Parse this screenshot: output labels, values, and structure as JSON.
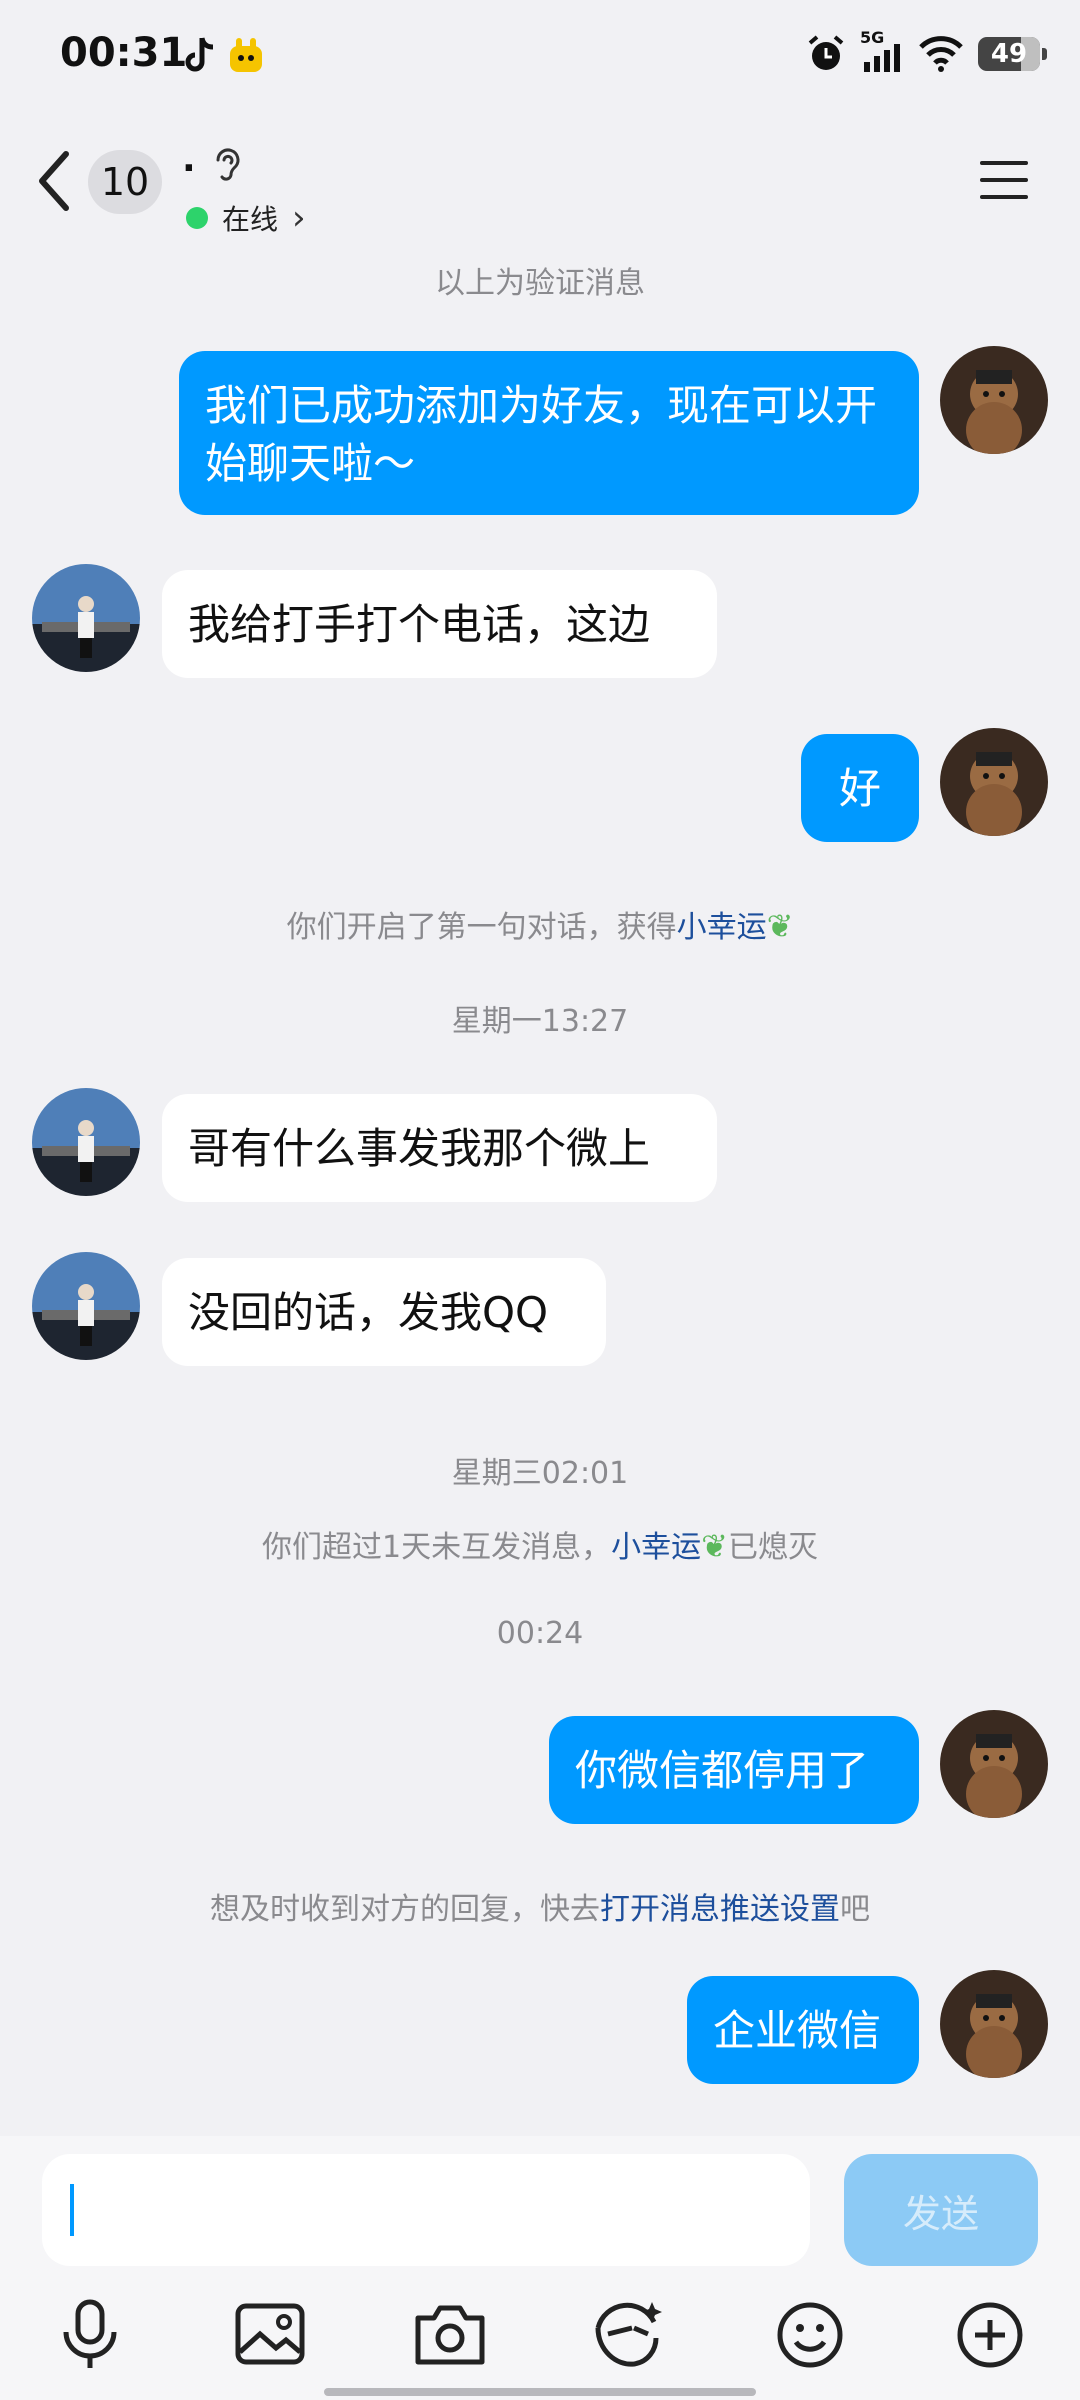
{
  "status_bar": {
    "time": "00:31",
    "signal_label": "5G",
    "battery": "49"
  },
  "header": {
    "back_count": "10",
    "contact_name": "·",
    "online_status": "在线",
    "chevron": "›"
  },
  "colors": {
    "accent": "#0099ff",
    "link": "#1d4f9c",
    "online": "#2dd36b"
  },
  "messages": {
    "verify_note": "以上为验证消息",
    "m1": "我们已成功添加为好友，现在可以开始聊天啦～",
    "m2": "我给打手打个电话，这边",
    "m3": "好",
    "sys1_prefix": "你们开启了第一句对话，获得",
    "sys1_link": "小幸运",
    "time1": "星期一13:27",
    "m4": "哥有什么事发我那个微上",
    "m5": "没回的话，发我QQ",
    "time2": "星期三02:01",
    "sys2_prefix": "你们超过1天未互发消息，",
    "sys2_link": "小幸运",
    "sys2_suffix": "已熄灭",
    "time3": "00:24",
    "m6": "你微信都停用了",
    "sys3_prefix": "想及时收到对方的回复，快去",
    "sys3_link": "打开消息推送设置",
    "sys3_suffix": "吧",
    "m7": "企业微信"
  },
  "input": {
    "value": "",
    "send_label": "发送"
  },
  "toolbar": {
    "icons": [
      "microphone-icon",
      "image-icon",
      "camera-icon",
      "face-effect-icon",
      "emoji-icon",
      "plus-icon"
    ]
  }
}
